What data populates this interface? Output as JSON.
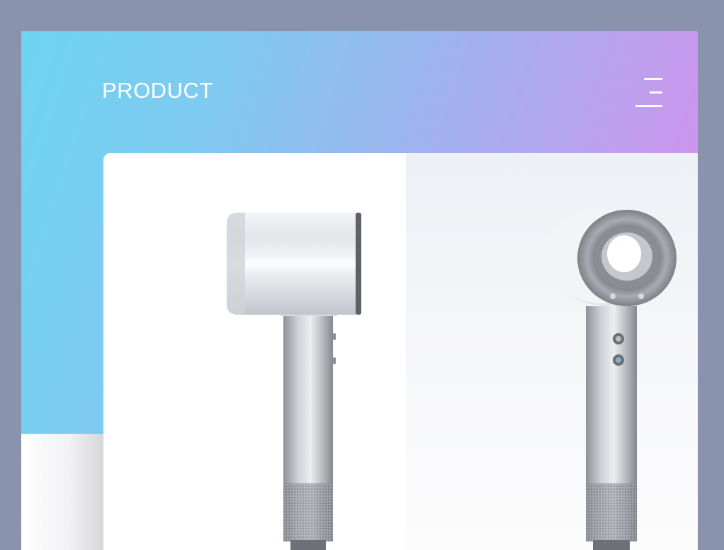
{
  "header": {
    "title": "PRODUCT",
    "menu_icon": "hamburger-menu-icon"
  },
  "colors": {
    "page_background": "#8a93ad",
    "gradient_start": "#6fd3f1",
    "gradient_mid": "#9ab6ee",
    "gradient_end": "#dc8cee",
    "card_background": "#ffffff"
  },
  "product_images": [
    {
      "view": "side",
      "icon": "hair-dryer-side-view"
    },
    {
      "view": "front",
      "icon": "hair-dryer-front-view"
    }
  ]
}
